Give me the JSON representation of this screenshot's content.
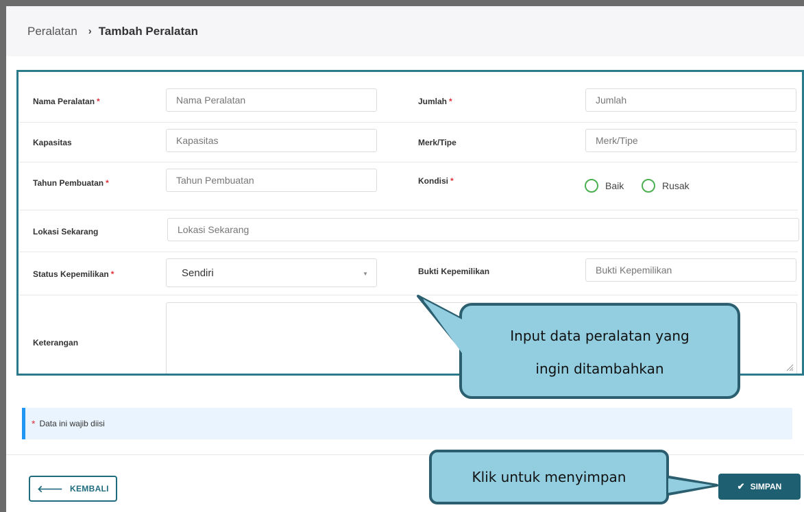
{
  "breadcrumb": {
    "root": "Peralatan",
    "separator": "›",
    "current": "Tambah Peralatan"
  },
  "form": {
    "nama_peralatan": {
      "label": "Nama Peralatan",
      "required": "*",
      "placeholder": "Nama Peralatan"
    },
    "jumlah": {
      "label": "Jumlah",
      "required": "*",
      "placeholder": "Jumlah"
    },
    "kapasitas": {
      "label": "Kapasitas",
      "placeholder": "Kapasitas"
    },
    "merk_tipe": {
      "label": "Merk/Tipe",
      "placeholder": "Merk/Tipe"
    },
    "tahun_pembuatan": {
      "label": "Tahun Pembuatan",
      "required": "*",
      "placeholder": "Tahun Pembuatan"
    },
    "kondisi": {
      "label": "Kondisi",
      "required": "*",
      "options": [
        "Baik",
        "Rusak"
      ]
    },
    "lokasi_sekarang": {
      "label": "Lokasi Sekarang",
      "placeholder": "Lokasi Sekarang"
    },
    "status_kepemilikan": {
      "label": "Status Kepemilikan",
      "required": "*",
      "selected": "Sendiri"
    },
    "bukti_kepemilikan": {
      "label": "Bukti Kepemilikan",
      "placeholder": "Bukti Kepemilikan"
    },
    "keterangan": {
      "label": "Keterangan"
    }
  },
  "note": {
    "star": "*",
    "text": "Data ini wajib diisi"
  },
  "buttons": {
    "kembali": "KEMBALI",
    "simpan": "SIMPAN"
  },
  "callouts": {
    "input": [
      "Input data peralatan yang",
      "ingin ditambahkan"
    ],
    "save": "Klik untuk menyimpan"
  },
  "icons": {
    "back": "arrow-left-icon",
    "save": "check-icon",
    "caret": "caret-down-icon"
  },
  "colors": {
    "accent": "#1f5f72",
    "required": "#e0303a",
    "radio": "#4caf50",
    "callout": "#92cde0",
    "note_border": "#2196f3"
  }
}
